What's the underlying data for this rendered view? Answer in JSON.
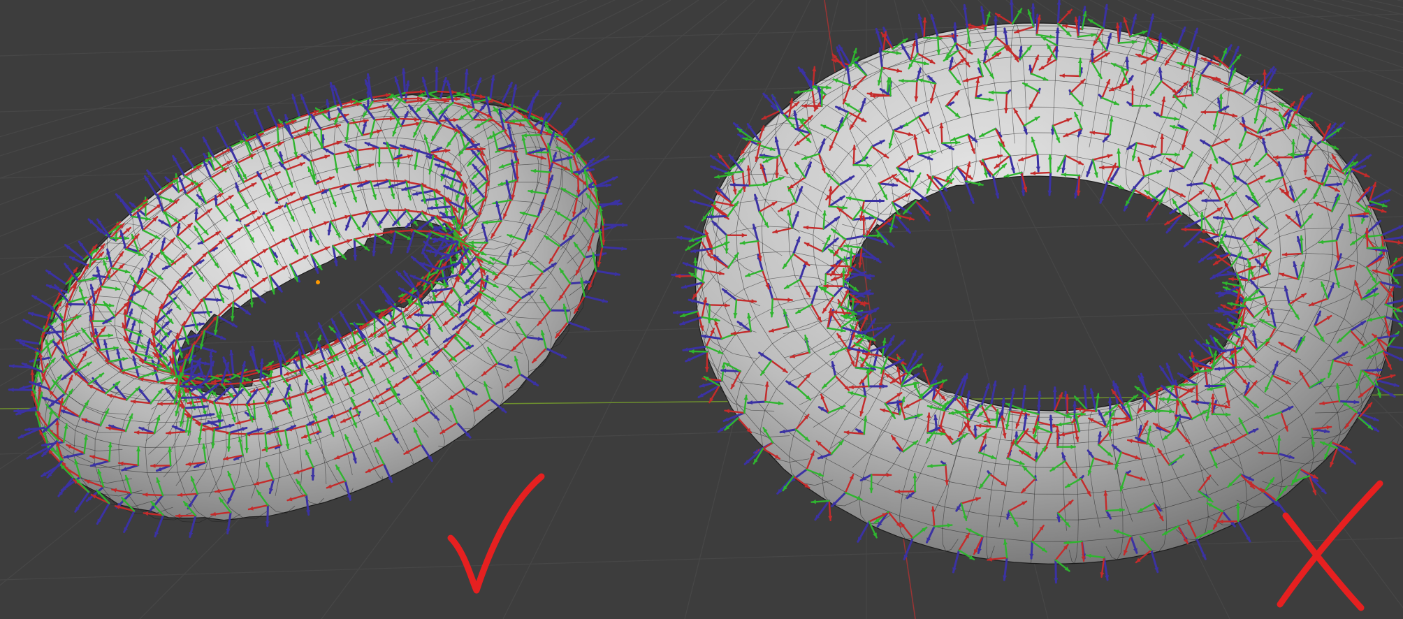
{
  "app": {
    "name": "3D Viewport"
  },
  "scene": {
    "background_color": "#3d3d3d",
    "grid_color": "#474747",
    "axis_x_color": "#9b3434",
    "axis_y_color": "#6d8f2e",
    "mesh_color": "#c9c9c9",
    "mesh_shadow_color": "#7a7a7a",
    "wire_color": "#1c1c1c",
    "tangent_color": "#c42b2b",
    "bitangent_color": "#2fb52f",
    "normal_color": "#3b32a3",
    "mark_color": "#e62020"
  },
  "objects": [
    {
      "id": "torus-left",
      "status": "correct",
      "mark": "check-mark",
      "arrow_pattern": "aligned"
    },
    {
      "id": "torus-right",
      "status": "incorrect",
      "mark": "cross-mark",
      "arrow_pattern": "random"
    }
  ],
  "origin_marker": {
    "color": "#ff9900"
  }
}
